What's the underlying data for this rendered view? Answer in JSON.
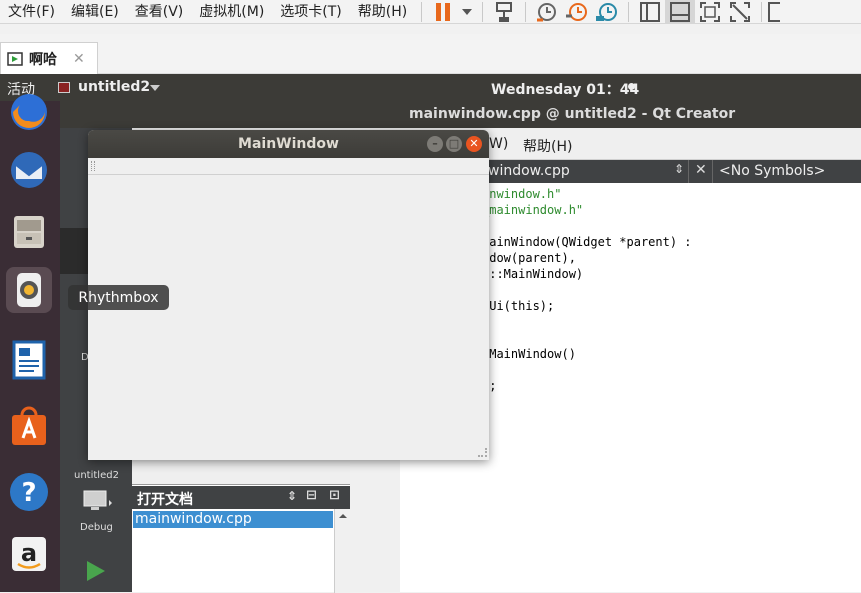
{
  "vmware": {
    "menu": [
      "文件(F)",
      "编辑(E)",
      "查看(V)",
      "虚拟机(M)",
      "选项卡(T)",
      "帮助(H)"
    ],
    "tab_label": "啊哈"
  },
  "ubuntu": {
    "activities": "活动",
    "app_menu": "untitled2",
    "clock": "Wednesday 01：44"
  },
  "qtcreator": {
    "window_title": "mainwindow.cpp @ untitled2 - Qt Creator",
    "menu_first_char": "文",
    "menu_partial": "W)",
    "menu_help": "帮助(H)",
    "editor_file": "window.cpp",
    "symbols": "<No Symbols>",
    "mode_labels": {
      "project": "untitled2",
      "debug_top": "Debu",
      "debug": "Debug"
    },
    "open_docs": {
      "title": "打开文档",
      "items": [
        "mainwindow.cpp"
      ]
    },
    "code": [
      {
        "text": "inwindow.h\"",
        "color": "#2e8b2e"
      },
      {
        "text": "_mainwindow.h\"",
        "color": "#2e8b2e"
      },
      {
        "text": "",
        "color": "#000"
      },
      {
        "text": "MainWindow(QWidget *parent) :",
        "color": "#000"
      },
      {
        "text": "ndow(parent),",
        "color": "#000"
      },
      {
        "text": "i::MainWindow)",
        "color": "#000"
      },
      {
        "text": "",
        "color": "#000"
      },
      {
        "text": "pUi(this);",
        "color": "#000"
      },
      {
        "text": "",
        "color": "#000"
      },
      {
        "text": "",
        "color": "#000"
      },
      {
        "text": "~MainWindow()",
        "color": "#000"
      },
      {
        "text": "",
        "color": "#000"
      },
      {
        "text": "i;",
        "color": "#000"
      }
    ]
  },
  "mainwindow": {
    "title": "MainWindow"
  },
  "tooltip": "Rhythmbox",
  "colors": {
    "ubuntu_panel": "#3c3b37",
    "dock": "#3a2d35",
    "close_button": "#e95420",
    "selection": "#3d8fd1"
  }
}
